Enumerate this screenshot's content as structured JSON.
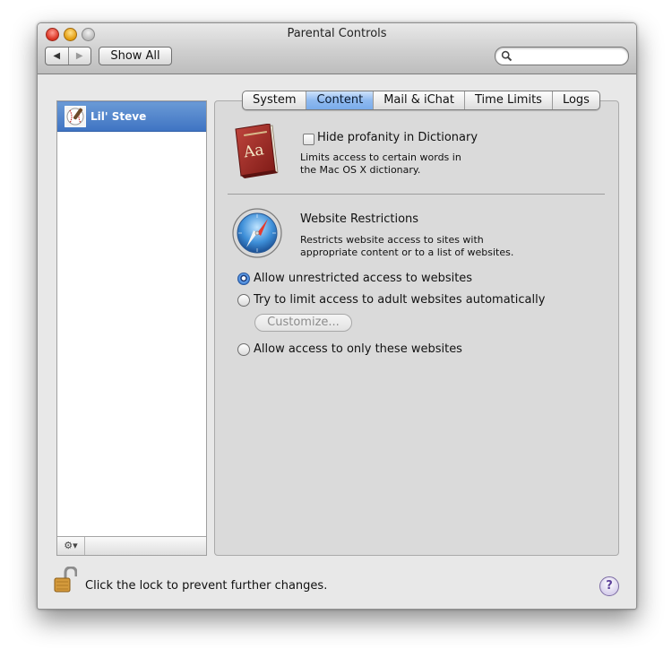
{
  "window": {
    "title": "Parental Controls"
  },
  "toolbar": {
    "back_icon": "◀",
    "forward_icon": "▶",
    "show_all_label": "Show All",
    "search": {
      "value": "",
      "placeholder": ""
    }
  },
  "sidebar": {
    "users": [
      {
        "name": "Lil' Steve",
        "selected": true
      }
    ],
    "footer_action_icon": "⚙▾"
  },
  "tabs": [
    {
      "label": "System",
      "selected": false
    },
    {
      "label": "Content",
      "selected": true
    },
    {
      "label": "Mail & iChat",
      "selected": false
    },
    {
      "label": "Time Limits",
      "selected": false
    },
    {
      "label": "Logs",
      "selected": false
    }
  ],
  "content": {
    "dictionary": {
      "checkbox_label": "Hide profanity in Dictionary",
      "checked": false,
      "desc_line1": "Limits access to certain words in",
      "desc_line2": "the Mac OS X dictionary."
    },
    "website": {
      "title": "Website Restrictions",
      "desc_line1": "Restricts website access to sites with",
      "desc_line2": "appropriate content or to a list of websites.",
      "options": [
        {
          "label": "Allow unrestricted access to websites",
          "selected": true
        },
        {
          "label": "Try to limit access to adult websites automatically",
          "selected": false
        },
        {
          "label": "Allow access to only these websites",
          "selected": false
        }
      ],
      "customize_label": "Customize..."
    }
  },
  "footer": {
    "lock_text": "Click the lock to prevent further changes.",
    "help_label": "?"
  },
  "colors": {
    "selection_blue": "#3f74c3",
    "tab_selected": "#8fbaf0"
  }
}
